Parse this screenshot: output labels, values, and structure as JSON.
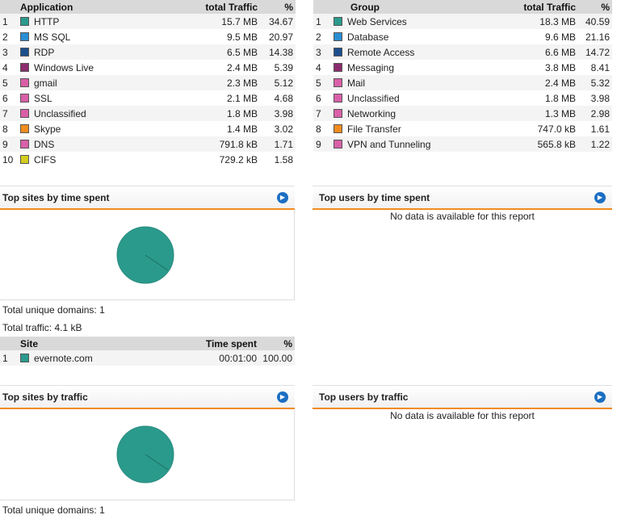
{
  "applications": {
    "headers": {
      "name": "Application",
      "traffic": "total Traffic",
      "pct": "%"
    },
    "rows": [
      {
        "rank": "1",
        "name": "HTTP",
        "traffic": "15.7 MB",
        "pct": "34.67",
        "color": "#2a9a8c"
      },
      {
        "rank": "2",
        "name": "MS SQL",
        "traffic": "9.5 MB",
        "pct": "20.97",
        "color": "#2a8ed3"
      },
      {
        "rank": "3",
        "name": "RDP",
        "traffic": "6.5 MB",
        "pct": "14.38",
        "color": "#1d4f8e"
      },
      {
        "rank": "4",
        "name": "Windows Live",
        "traffic": "2.4 MB",
        "pct": "5.39",
        "color": "#8b2c6e"
      },
      {
        "rank": "5",
        "name": "gmail",
        "traffic": "2.3 MB",
        "pct": "5.12",
        "color": "#d95fa7"
      },
      {
        "rank": "6",
        "name": "SSL",
        "traffic": "2.1 MB",
        "pct": "4.68",
        "color": "#d95fa7"
      },
      {
        "rank": "7",
        "name": "Unclassified",
        "traffic": "1.8 MB",
        "pct": "3.98",
        "color": "#d95fa7"
      },
      {
        "rank": "8",
        "name": "Skype",
        "traffic": "1.4 MB",
        "pct": "3.02",
        "color": "#f08c1e"
      },
      {
        "rank": "9",
        "name": "DNS",
        "traffic": "791.8 kB",
        "pct": "1.71",
        "color": "#d95fa7"
      },
      {
        "rank": "10",
        "name": "CIFS",
        "traffic": "729.2 kB",
        "pct": "1.58",
        "color": "#d4cc1f"
      }
    ]
  },
  "groups": {
    "headers": {
      "name": "Group",
      "traffic": "total Traffic",
      "pct": "%"
    },
    "rows": [
      {
        "rank": "1",
        "name": "Web Services",
        "traffic": "18.3 MB",
        "pct": "40.59",
        "color": "#2a9a8c"
      },
      {
        "rank": "2",
        "name": "Database",
        "traffic": "9.6 MB",
        "pct": "21.16",
        "color": "#2a8ed3"
      },
      {
        "rank": "3",
        "name": "Remote Access",
        "traffic": "6.6 MB",
        "pct": "14.72",
        "color": "#1d4f8e"
      },
      {
        "rank": "4",
        "name": "Messaging",
        "traffic": "3.8 MB",
        "pct": "8.41",
        "color": "#8b2c6e"
      },
      {
        "rank": "5",
        "name": "Mail",
        "traffic": "2.4 MB",
        "pct": "5.32",
        "color": "#d95fa7"
      },
      {
        "rank": "6",
        "name": "Unclassified",
        "traffic": "1.8 MB",
        "pct": "3.98",
        "color": "#d95fa7"
      },
      {
        "rank": "7",
        "name": "Networking",
        "traffic": "1.3 MB",
        "pct": "2.98",
        "color": "#d95fa7"
      },
      {
        "rank": "8",
        "name": "File Transfer",
        "traffic": "747.0 kB",
        "pct": "1.61",
        "color": "#f08c1e"
      },
      {
        "rank": "9",
        "name": "VPN and Tunneling",
        "traffic": "565.8 kB",
        "pct": "1.22",
        "color": "#d95fa7"
      }
    ]
  },
  "sites_time": {
    "title": "Top sites by time spent",
    "pie_color": "#2a9a8c",
    "total_domains": "Total unique domains: 1",
    "total_traffic": "Total traffic: 4.1 kB",
    "headers": {
      "site": "Site",
      "time": "Time spent",
      "pct": "%"
    },
    "rows": [
      {
        "rank": "1",
        "site": "evernote.com",
        "time": "00:01:00",
        "pct": "100.00",
        "color": "#2a9a8c"
      }
    ]
  },
  "users_time": {
    "title": "Top users by time spent",
    "message": "No data is available for this report"
  },
  "sites_traffic": {
    "title": "Top sites by traffic",
    "pie_color": "#2a9a8c",
    "total_domains": "Total unique domains: 1"
  },
  "users_traffic": {
    "title": "Top users by traffic",
    "message": "No data is available for this report"
  },
  "icons": {
    "go": "play-circle-icon"
  }
}
